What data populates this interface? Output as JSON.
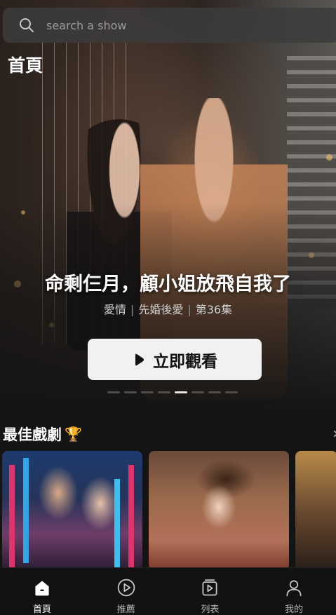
{
  "search": {
    "placeholder": "search a show",
    "icon": "search-icon"
  },
  "page_title": "首頁",
  "featured": {
    "title": "命剩仨月，顧小姐放飛自我了",
    "genre": "愛情",
    "tag": "先婚後愛",
    "episode": "第36集",
    "watch_label": "立即觀看",
    "carousel_count": 8,
    "carousel_active_index": 4
  },
  "section": {
    "title": "最佳戲劇",
    "badge_icon": "trophy-icon"
  },
  "bottom_nav": {
    "items": [
      {
        "label": "首頁",
        "icon": "home-icon",
        "active": true
      },
      {
        "label": "推薦",
        "icon": "play-circle-icon",
        "active": false
      },
      {
        "label": "列表",
        "icon": "playlist-icon",
        "active": false
      },
      {
        "label": "我的",
        "icon": "profile-icon",
        "active": false
      }
    ]
  },
  "colors": {
    "background": "#141414",
    "button_bg": "#f1f1f1",
    "trophy": "#f2b705"
  }
}
